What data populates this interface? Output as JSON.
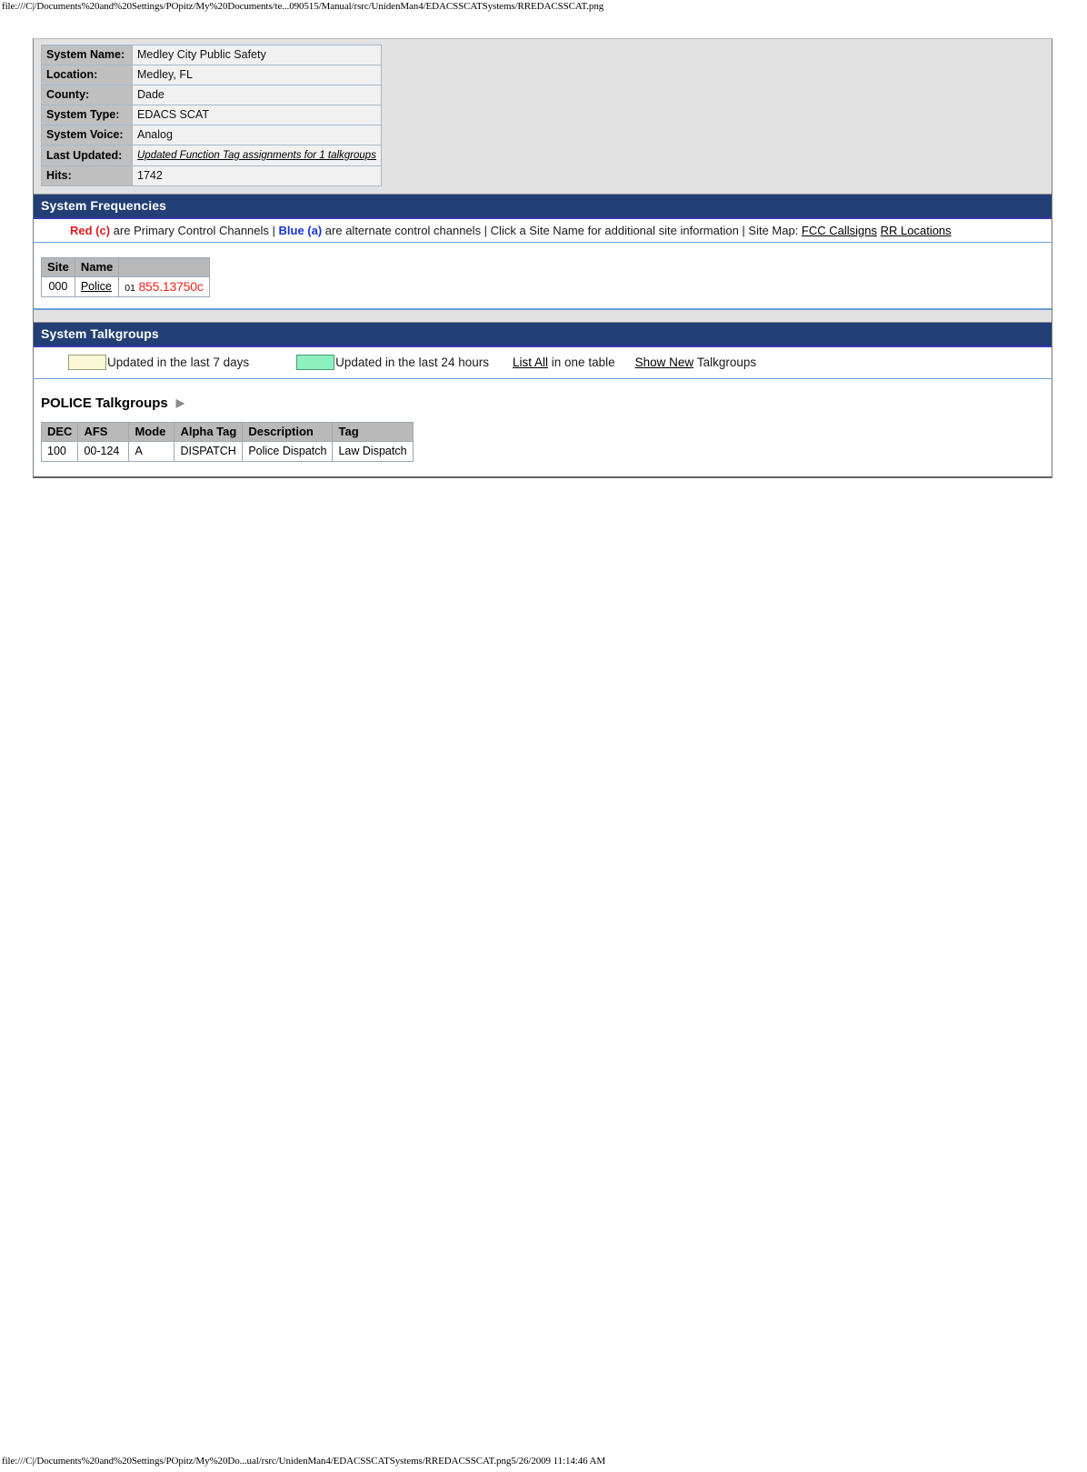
{
  "print": {
    "header_url": "file:///C|/Documents%20and%20Settings/POpitz/My%20Documents/te...090515/Manual/rsrc/UnidenMan4/EDACSSCATSystems/RREDACSSCAT.png",
    "footer_url": "file:///C|/Documents%20and%20Settings/POpitz/My%20Do...ual/rsrc/UnidenMan4/EDACSSCATSystems/RREDACSSCAT.png5/26/2009 11:14:46 AM"
  },
  "system_info": {
    "rows": [
      {
        "label": "System Name:",
        "value": "Medley City Public Safety"
      },
      {
        "label": "Location:",
        "value": "Medley, FL"
      },
      {
        "label": "County:",
        "value": "Dade"
      },
      {
        "label": "System Type:",
        "value": "EDACS SCAT"
      },
      {
        "label": "System Voice:",
        "value": "Analog"
      },
      {
        "label": "Last Updated:",
        "value": "Updated Function Tag assignments for 1 talkgroups"
      },
      {
        "label": "Hits:",
        "value": "1742"
      }
    ]
  },
  "frequencies": {
    "section_title": "System Frequencies",
    "legend": {
      "red_label": "Red (c)",
      "red_text": " are Primary Control Channels | ",
      "blue_label": "Blue (a)",
      "blue_text": " are alternate control channels | Click a Site Name for additional site information | Site Map: ",
      "link_fcc": "FCC Callsigns",
      "link_rr": "RR Locations"
    },
    "table": {
      "headers": [
        "Site",
        "Name",
        ""
      ],
      "rows": [
        {
          "site": "000",
          "name": "Police",
          "channel": "01",
          "freq": "855.13750c"
        }
      ]
    }
  },
  "talkgroups": {
    "section_title": "System Talkgroups",
    "legend": {
      "yellow_text": "Updated in the last 7 days",
      "green_text": "Updated in the last 24 hours",
      "list_all_link": "List All",
      "list_all_text": "in one table",
      "show_new_link": "Show New",
      "show_new_text": "Talkgroups"
    },
    "group_title": "POLICE Talkgroups",
    "table": {
      "headers": [
        "DEC",
        "AFS",
        "Mode",
        "Alpha Tag",
        "Description",
        "Tag"
      ],
      "rows": [
        {
          "dec": "100",
          "afs": "00-124",
          "mode": "A",
          "alpha_tag": "DISPATCH",
          "description": "Police Dispatch",
          "tag": "Law Dispatch"
        }
      ]
    }
  },
  "colors": {
    "section_bar": "#223f75",
    "control_red": "#f5241d",
    "alt_blue": "#1734d8",
    "swatch_yellow": "#fbf8d8",
    "swatch_green": "#8df0bf"
  }
}
